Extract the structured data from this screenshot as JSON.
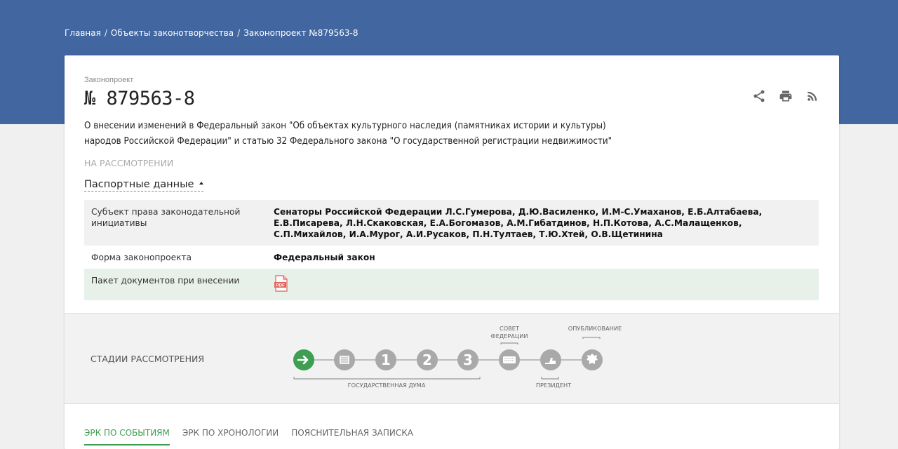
{
  "breadcrumb": {
    "items": [
      "Главная",
      "Объекты законотворчества",
      "Законопроект №879563-8"
    ],
    "separator": "/"
  },
  "bill": {
    "kind": "Законопроект",
    "number": "№ 879563-8",
    "description": "О внесении изменений в Федеральный закон \"Об объектах культурного наследия (памятниках истории и культуры) народов Российской Федерации\" и статью 32 Федерального закона \"О государственной регистрации недвижимости\"",
    "status": "НА РАССМОТРЕНИИ"
  },
  "actions": [
    "share-icon",
    "print-icon",
    "rss-icon"
  ],
  "passport": {
    "title": "Паспортные данные",
    "rows": [
      {
        "label": "Субъект права законодательной инициативы",
        "value": "Сенаторы Российской Федерации Л.С.Гумерова, Д.Ю.Василенко, И.М-С.Умаханов, Е.Б.Алтабаева, Е.В.Писарева, Л.Н.Скаковская, Е.А.Богомазов, А.М.Гибатдинов, Н.П.Котова, А.С.Малащенков, С.П.Михайлов, И.А.Мурог, А.И.Русаков, П.Н.Тултаев, Т.Ю.Хтей, О.В.Щетинина"
      },
      {
        "label": "Форма законопроекта",
        "value": "Федеральный закон"
      },
      {
        "label": "Пакет документов при внесении",
        "value": "",
        "icon": "pdf-icon",
        "icon_text": "PDF"
      }
    ]
  },
  "stages": {
    "label": "СТАДИИ РАССМОТРЕНИЯ",
    "group_labels": {
      "duma": "ГОСУДАРСТВЕННАЯ ДУМА",
      "federation": [
        "СОВЕТ",
        "ФЕДЕРАЦИИ"
      ],
      "president": "ПРЕЗИДЕНТ",
      "published": "ОПУБЛИКОВАНИЕ"
    },
    "steps": [
      {
        "name": "introduction",
        "icon": "arrow-right-icon",
        "active": true
      },
      {
        "name": "preliminary",
        "icon": "list-icon",
        "active": false
      },
      {
        "name": "reading-1",
        "text": "1",
        "active": false
      },
      {
        "name": "reading-2",
        "text": "2",
        "active": false
      },
      {
        "name": "reading-3",
        "text": "3",
        "active": false
      },
      {
        "name": "federation-council",
        "icon": "keyboard-icon",
        "active": false
      },
      {
        "name": "president",
        "icon": "hand-icon",
        "active": false
      },
      {
        "name": "publication",
        "icon": "emblem-icon",
        "active": false
      }
    ],
    "colors": {
      "active": "#3e9e52",
      "inactive": "#a9a9a9"
    }
  },
  "tabs": [
    {
      "label": "ЭРК ПО СОБЫТИЯМ",
      "active": true
    },
    {
      "label": "ЭРК ПО ХРОНОЛОГИИ",
      "active": false
    },
    {
      "label": "ПОЯСНИТЕЛЬНАЯ ЗАПИСКА",
      "active": false
    }
  ],
  "colors": {
    "header": "#42669f",
    "accent": "#3e9e52"
  }
}
